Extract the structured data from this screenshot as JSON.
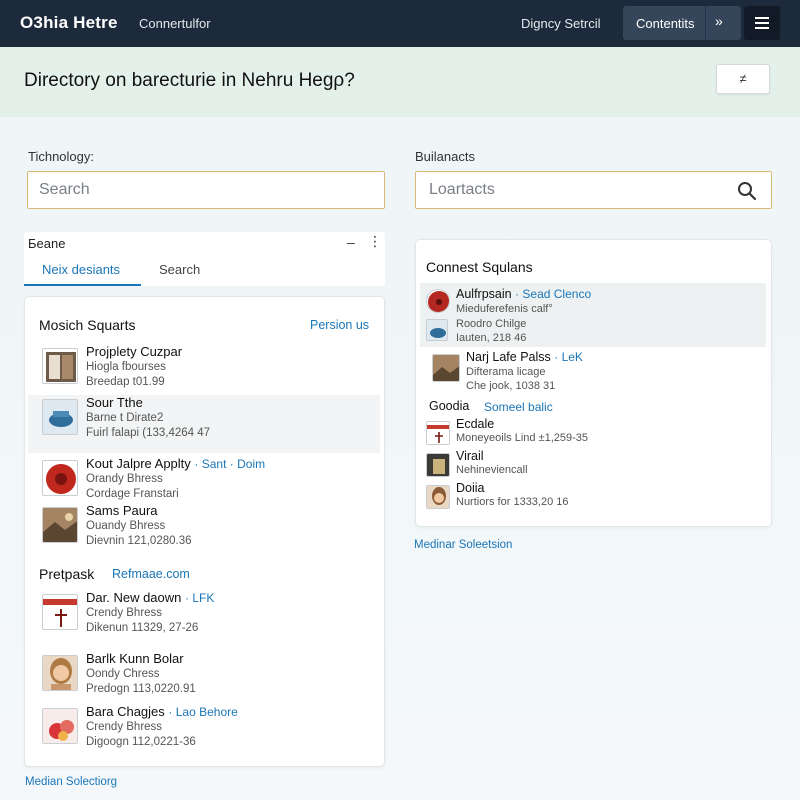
{
  "topbar": {
    "brand": "O3hia Hetre",
    "link_left": "Connertulfor",
    "link_right": "Digncy Setrcil",
    "button_label": "Contentits",
    "button_arrow": "»"
  },
  "header": {
    "title": "Directory on barecturie in Nehru Hegρ?",
    "action_label": "≠"
  },
  "left_search": {
    "label": "Tichnology:",
    "placeholder": "Search"
  },
  "right_search": {
    "label": "Builanacts",
    "placeholder": "Loartacts"
  },
  "tabs": {
    "title": "Бeane",
    "minimize": "–",
    "more": "⋮",
    "items": [
      "Neix desiants",
      "Search"
    ]
  },
  "left_card": {
    "section1_title": "Mosich Squarts",
    "section1_link": "Persion us",
    "section2_title": "Pretpask",
    "section2_link": "Refmaae.com",
    "items": [
      {
        "name": "Projplety Cuzpar",
        "tag": "",
        "line2": "Hiogla fbourses",
        "line3": "Breedap t01.99"
      },
      {
        "name": "Sour Tthe",
        "tag": "",
        "line2": "Barne t Dirate2",
        "line3": "Fuirl falapi (133,4264 47"
      },
      {
        "name": "Kout Jalpre Applty",
        "tag": "· Sant · Doim",
        "line2": "Orandy Bhress",
        "line3": "Cordage Franstari"
      },
      {
        "name": "Sams Paura",
        "tag": "",
        "line2": "Ouandy Bhress",
        "line3": "Dievnin 121,0280.36"
      },
      {
        "name": "Dar. New daown",
        "tag": "· LFK",
        "line2": "Crendy Bhress",
        "line3": "Dikenun 11329, 27-26"
      },
      {
        "name": "Barlk Kunn Bolar",
        "tag": "",
        "line2": "Oondy Chress",
        "line3": "Predogn 113,0220.91"
      },
      {
        "name": "Bara Chagjes",
        "tag": "· Lao Behore",
        "line2": "Crendy Bhress",
        "line3": "Digoogn 112,0221-36"
      }
    ],
    "footer_link": "Median Solectiorg"
  },
  "right_card": {
    "title": "Connest Squlans",
    "items": [
      {
        "name": "Aulfrpsain",
        "tag": "· Sead Clenco",
        "sub": "Mieduferefenis calf°"
      },
      {
        "name": "",
        "tag": "",
        "sub1": "Roodro Chilge",
        "sub2": "Iauten, 218 46"
      },
      {
        "name": "Narj Lafe Palss",
        "tag": "· LeK",
        "sub1": "Difterama licage",
        "sub2": "Che jook, 1038 31"
      }
    ],
    "group_title": "Goodia",
    "group_link": "Someel balic",
    "group_items": [
      {
        "name": "Ecdale",
        "sub": "Moneyeoils Lind ±1,259-35"
      },
      {
        "name": "Virail",
        "sub": "Nehineviencall"
      },
      {
        "name": "Doiia",
        "sub": "Nurtiors for 1333,20 16"
      }
    ],
    "footer_link": "Medinar Soleetsion"
  }
}
